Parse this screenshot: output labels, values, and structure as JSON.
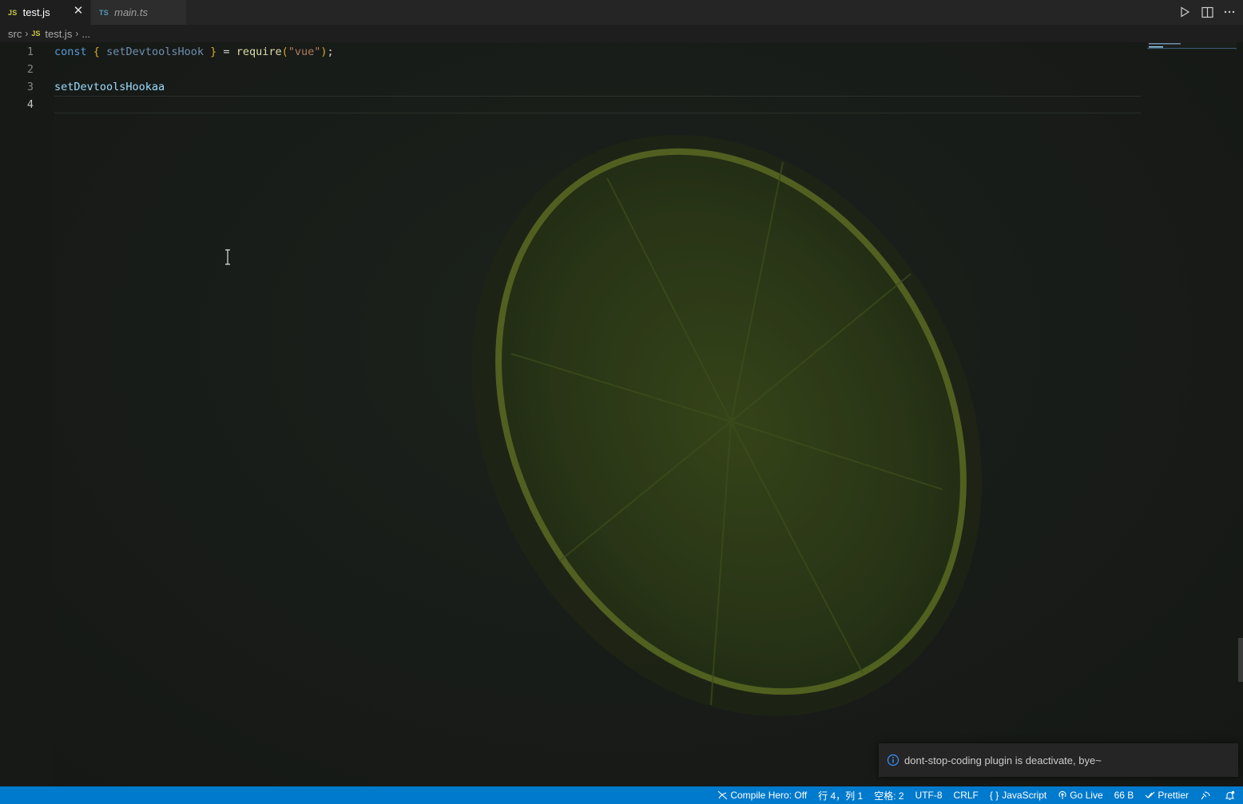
{
  "tabs": [
    {
      "lang": "JS",
      "name": "test.js",
      "close": "✕"
    },
    {
      "lang": "TS",
      "name": "main.ts"
    }
  ],
  "breadcrumb": {
    "folder": "src",
    "file_lang": "JS",
    "file": "test.js",
    "more": "..."
  },
  "editor": {
    "line_numbers": [
      "1",
      "2",
      "3",
      "4"
    ],
    "line1": {
      "const": "const",
      "open_brace": "{",
      "ident": "setDevtoolsHook",
      "close_brace": "}",
      "equals": "=",
      "require": "require",
      "open_paren": "(",
      "string": "\"vue\"",
      "close_paren": ")",
      "semi": ";"
    },
    "line3": "setDevtoolsHookaa"
  },
  "notification": {
    "message": "dont-stop-coding plugin is deactivate, bye~"
  },
  "statusbar": {
    "compile_hero": "Compile Hero: Off",
    "position": "行 4，列 1",
    "spaces": "空格: 2",
    "encoding": "UTF-8",
    "eol": "CRLF",
    "language": "JavaScript",
    "go_live": "Go Live",
    "size": "66 B",
    "prettier": "Prettier"
  },
  "colors": {
    "statusbar": "#007acc",
    "tab_active": "#1e1e1e",
    "js_icon": "#cbcb41",
    "ts_icon": "#519aba"
  }
}
